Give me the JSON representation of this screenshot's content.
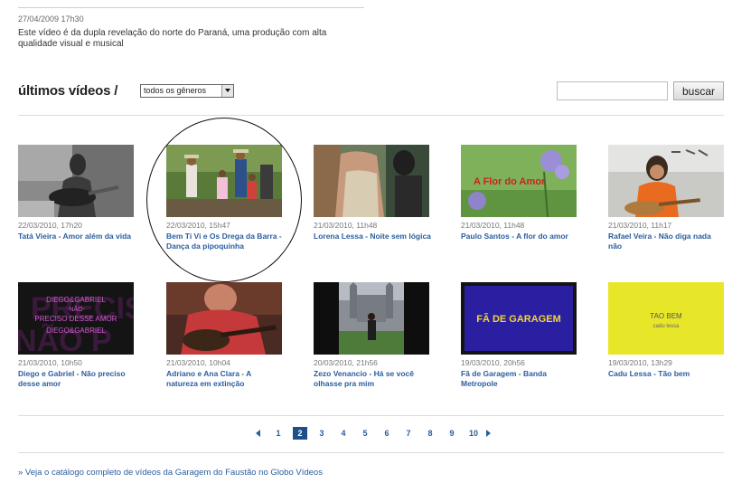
{
  "top": {
    "date": "27/04/2009 17h30",
    "description": "Este vídeo é da dupla revelação do norte do Paraná, uma produção com alta qualidade visual e musical"
  },
  "section": {
    "title": "últimos vídeos /",
    "genre_selected": "todos os gêneros"
  },
  "search": {
    "value": "",
    "button_label": "buscar"
  },
  "videos": [
    {
      "date": "22/03/2010, 17h20",
      "title": "Tatá Vieira - Amor além da vida"
    },
    {
      "date": "22/03/2010, 15h47",
      "title": "Bem Ti Vi e Os Drega da Barra - Dança da pipoquinha"
    },
    {
      "date": "21/03/2010, 11h48",
      "title": "Lorena Lessa - Noite sem lógica"
    },
    {
      "date": "21/03/2010, 11h48",
      "title": "Paulo Santos - A flor do amor"
    },
    {
      "date": "21/03/2010, 11h17",
      "title": "Rafael Veira - Não diga nada não"
    },
    {
      "date": "21/03/2010, 10h50",
      "title": "Diego e Gabriel - Não preciso desse amor"
    },
    {
      "date": "21/03/2010, 10h04",
      "title": "Adriano e Ana Clara - A natureza em extinção"
    },
    {
      "date": "20/03/2010, 21h56",
      "title": "Zezo Venancio - Há se você olhasse pra mim"
    },
    {
      "date": "19/03/2010, 20h56",
      "title": "Fã de Garagem - Banda Metropole"
    },
    {
      "date": "19/03/2010, 13h29",
      "title": "Cadu Lessa - Tão bem"
    }
  ],
  "thumb_text": {
    "flor_do_amor": "A  Flor do Amor",
    "diego_line1": "DIEGO&GABRIEL",
    "diego_line2": "-NÃO-",
    "diego_line3": "PRECISO DESSE AMOR",
    "diego_line4": "DIEGO&GABRIEL",
    "diego_bg1": "PRECIS",
    "diego_bg2": "NÃO P",
    "fa_garagem": "FÃ DE GARAGEM",
    "tao_bem1": "TAO BEM",
    "tao_bem2": "cadu lessa"
  },
  "pagination": {
    "current": "2",
    "pages": [
      "1",
      "2",
      "3",
      "4",
      "5",
      "6",
      "7",
      "8",
      "9",
      "10"
    ]
  },
  "footer": {
    "catalog_link": "» Veja o catálogo completo de vídeos da Garagem do Faustão no Globo Vídeos"
  }
}
